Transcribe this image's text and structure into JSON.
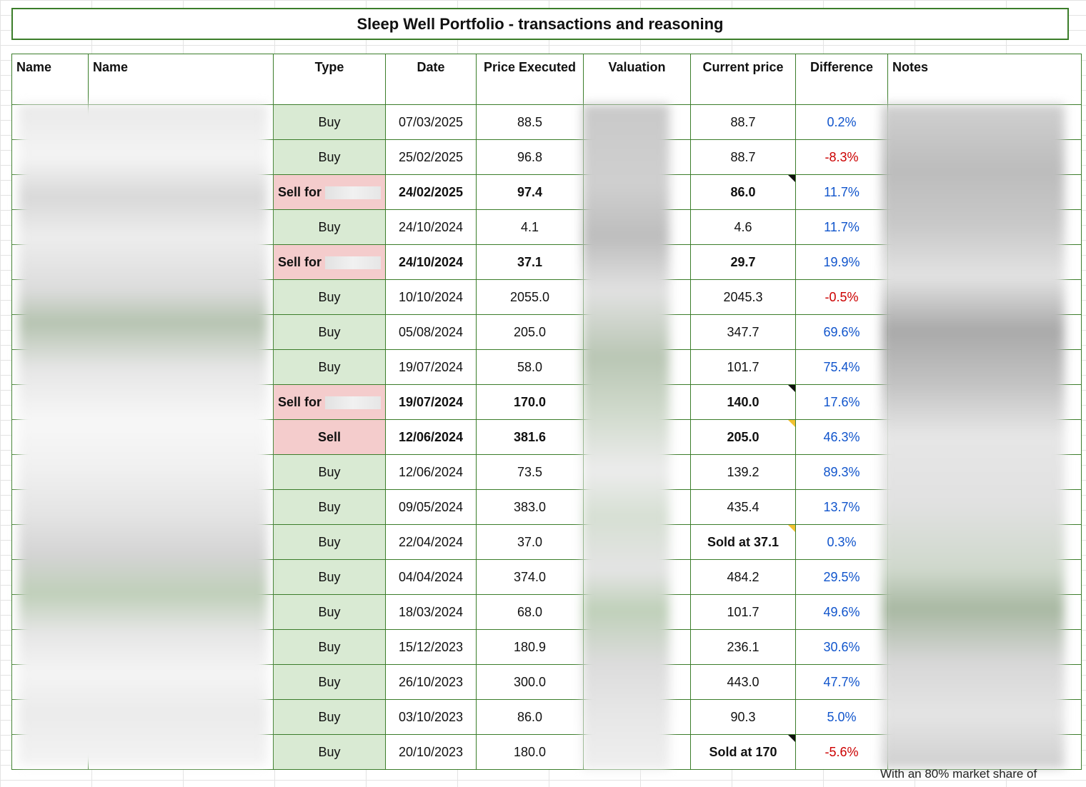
{
  "title": "Sleep Well Portfolio - transactions and reasoning",
  "headers": {
    "name1": "Name",
    "name2": "Name",
    "type": "Type",
    "date": "Date",
    "price_executed": "Price Executed",
    "valuation": "Valuation",
    "current_price": "Current price",
    "difference": "Difference",
    "notes": "Notes"
  },
  "rows": [
    {
      "type": "Buy",
      "date": "07/03/2025",
      "price": "88.5",
      "current": "88.7",
      "diff": "0.2%",
      "sign": "pos",
      "bold": false,
      "marker": ""
    },
    {
      "type": "Buy",
      "date": "25/02/2025",
      "price": "96.8",
      "current": "88.7",
      "diff": "-8.3%",
      "sign": "neg",
      "bold": false,
      "marker": ""
    },
    {
      "type": "Sell for",
      "date": "24/02/2025",
      "price": "97.4",
      "current": "86.0",
      "diff": "11.7%",
      "sign": "pos",
      "bold": true,
      "marker": "black"
    },
    {
      "type": "Buy",
      "date": "24/10/2024",
      "price": "4.1",
      "current": "4.6",
      "diff": "11.7%",
      "sign": "pos",
      "bold": false,
      "marker": ""
    },
    {
      "type": "Sell for",
      "date": "24/10/2024",
      "price": "37.1",
      "current": "29.7",
      "diff": "19.9%",
      "sign": "pos",
      "bold": true,
      "marker": ""
    },
    {
      "type": "Buy",
      "date": "10/10/2024",
      "price": "2055.0",
      "current": "2045.3",
      "diff": "-0.5%",
      "sign": "neg",
      "bold": false,
      "marker": ""
    },
    {
      "type": "Buy",
      "date": "05/08/2024",
      "price": "205.0",
      "current": "347.7",
      "diff": "69.6%",
      "sign": "pos",
      "bold": false,
      "marker": ""
    },
    {
      "type": "Buy",
      "date": "19/07/2024",
      "price": "58.0",
      "current": "101.7",
      "diff": "75.4%",
      "sign": "pos",
      "bold": false,
      "marker": ""
    },
    {
      "type": "Sell for",
      "date": "19/07/2024",
      "price": "170.0",
      "current": "140.0",
      "diff": "17.6%",
      "sign": "pos",
      "bold": true,
      "marker": "black"
    },
    {
      "type": "Sell",
      "date": "12/06/2024",
      "price": "381.6",
      "current": "205.0",
      "diff": "46.3%",
      "sign": "pos",
      "bold": true,
      "marker": "yellow"
    },
    {
      "type": "Buy",
      "date": "12/06/2024",
      "price": "73.5",
      "current": "139.2",
      "diff": "89.3%",
      "sign": "pos",
      "bold": false,
      "marker": ""
    },
    {
      "type": "Buy",
      "date": "09/05/2024",
      "price": "383.0",
      "current": "435.4",
      "diff": "13.7%",
      "sign": "pos",
      "bold": false,
      "marker": ""
    },
    {
      "type": "Buy",
      "date": "22/04/2024",
      "price": "37.0",
      "current": "Sold at 37.1",
      "diff": "0.3%",
      "sign": "pos",
      "bold": false,
      "current_bold": true,
      "marker": "yellow"
    },
    {
      "type": "Buy",
      "date": "04/04/2024",
      "price": "374.0",
      "current": "484.2",
      "diff": "29.5%",
      "sign": "pos",
      "bold": false,
      "marker": ""
    },
    {
      "type": "Buy",
      "date": "18/03/2024",
      "price": "68.0",
      "current": "101.7",
      "diff": "49.6%",
      "sign": "pos",
      "bold": false,
      "marker": ""
    },
    {
      "type": "Buy",
      "date": "15/12/2023",
      "price": "180.9",
      "current": "236.1",
      "diff": "30.6%",
      "sign": "pos",
      "bold": false,
      "marker": ""
    },
    {
      "type": "Buy",
      "date": "26/10/2023",
      "price": "300.0",
      "current": "443.0",
      "diff": "47.7%",
      "sign": "pos",
      "bold": false,
      "marker": ""
    },
    {
      "type": "Buy",
      "date": "03/10/2023",
      "price": "86.0",
      "current": "90.3",
      "diff": "5.0%",
      "sign": "pos",
      "bold": false,
      "marker": ""
    },
    {
      "type": "Buy",
      "date": "20/10/2023",
      "price": "180.0",
      "current": "Sold at 170",
      "diff": "-5.6%",
      "sign": "neg",
      "bold": false,
      "current_bold": true,
      "marker": "black"
    }
  ],
  "notes_cut_text": "With an 80% market share of",
  "colors": {
    "border": "#3b7d2a",
    "buy_fill": "#d9ead3",
    "sell_fill": "#f4cccc",
    "positive": "#1155cc",
    "negative": "#cc0000"
  }
}
